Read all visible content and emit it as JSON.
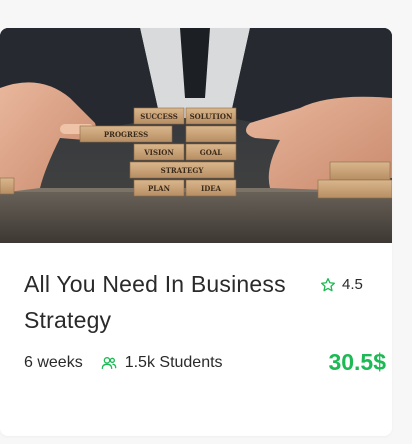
{
  "course": {
    "title": "All You Need In Business Strategy",
    "rating": "4.5",
    "duration": "6 weeks",
    "students": "1.5k Students",
    "price": "30.5$"
  },
  "image": {
    "blocks": [
      "SUCCESS",
      "SOLUTION",
      "PROGRESS",
      "VISION",
      "GOAL",
      "STRATEGY",
      "PLAN",
      "IDEA"
    ]
  },
  "icons": {
    "rating": "star-outline-icon",
    "students": "users-icon"
  },
  "colors": {
    "accent": "#1db954",
    "text": "#2a2a2a",
    "card": "#ffffff",
    "background": "#f7f7f7"
  }
}
